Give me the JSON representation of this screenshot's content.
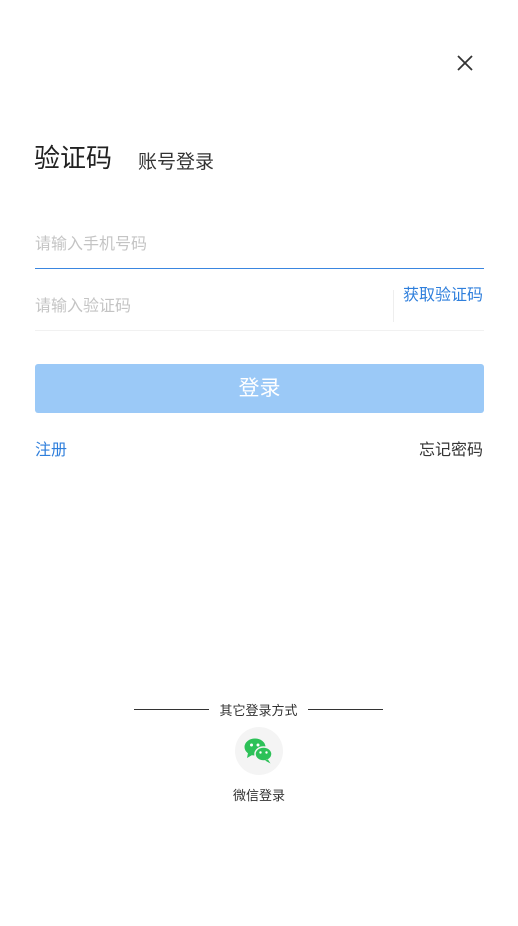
{
  "header": {
    "close_icon": "close-icon"
  },
  "tabs": {
    "active_label": "验证码",
    "inactive_label": "账号登录"
  },
  "form": {
    "phone_placeholder": "请输入手机号码",
    "phone_value": "",
    "code_placeholder": "请输入验证码",
    "code_value": "",
    "get_code_label": "获取验证码",
    "login_label": "登录"
  },
  "links": {
    "register": "注册",
    "forgot_password": "忘记密码"
  },
  "other_login": {
    "title": "其它登录方式",
    "wechat_label": "微信登录",
    "wechat_icon": "wechat-icon"
  },
  "colors": {
    "accent": "#2f7fdc",
    "login_button": "#9bc9f7",
    "wechat_green": "#2dc158"
  }
}
